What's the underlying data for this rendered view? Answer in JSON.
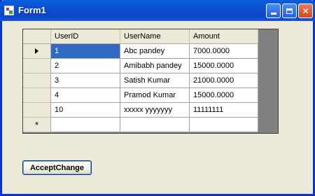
{
  "window": {
    "title": "Form1",
    "icons": {
      "app": "form-app-icon",
      "minimize": "minimize-icon",
      "maximize": "maximize-icon",
      "close": "close-icon"
    },
    "close_glyph": "✕"
  },
  "grid": {
    "columns": [
      "UserID",
      "UserName",
      "Amount"
    ],
    "rows": [
      {
        "user_id": "1",
        "user_name": "Abc pandey",
        "amount": "7000.0000",
        "current": true
      },
      {
        "user_id": "2",
        "user_name": "Amibabh pandey",
        "amount": "15000.0000"
      },
      {
        "user_id": "3",
        "user_name": "Satish Kumar",
        "amount": "21000.0000"
      },
      {
        "user_id": "4",
        "user_name": "Pramod Kumar",
        "amount": "15000.0000"
      },
      {
        "user_id": "10",
        "user_name": "xxxxx yyyyyyy",
        "amount": "11111111"
      }
    ],
    "new_row_marker": "*",
    "current_row_icon": "row-pointer-arrow-icon",
    "colors": {
      "selection": "#316ac5",
      "background": "#808080"
    }
  },
  "buttons": {
    "accept_change": "AcceptChange"
  }
}
